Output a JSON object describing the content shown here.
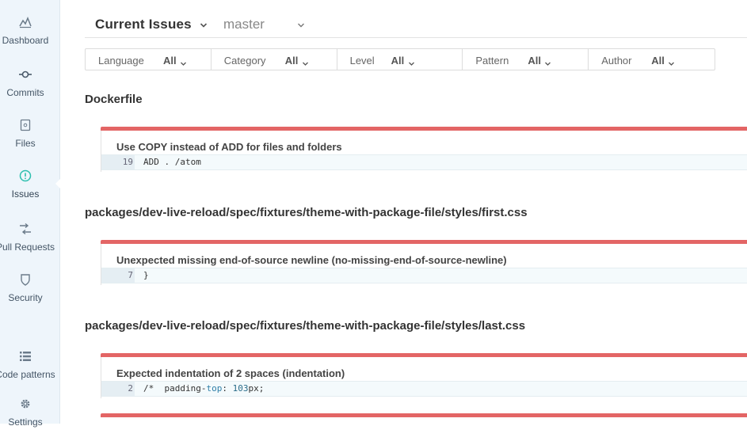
{
  "sidebar": {
    "items": [
      {
        "label": "Dashboard",
        "icon": "dashboard-icon"
      },
      {
        "label": "Commits",
        "icon": "commit-icon"
      },
      {
        "label": "Files",
        "icon": "file-icon"
      },
      {
        "label": "Issues",
        "icon": "alert-circle-icon",
        "active": true
      },
      {
        "label": "Pull Requests",
        "icon": "pull-request-icon"
      },
      {
        "label": "Security",
        "icon": "shield-icon"
      },
      {
        "label": "Code patterns",
        "icon": "list-icon"
      },
      {
        "label": "Settings",
        "icon": "gear-icon"
      }
    ]
  },
  "header": {
    "title": "Current Issues",
    "branch": "master"
  },
  "filters": [
    {
      "name": "Language",
      "value": "All"
    },
    {
      "name": "Category",
      "value": "All"
    },
    {
      "name": "Level",
      "value": "All"
    },
    {
      "name": "Pattern",
      "value": "All"
    },
    {
      "name": "Author",
      "value": "All"
    }
  ],
  "files": [
    {
      "path": "Dockerfile",
      "issues": [
        {
          "message": "Use COPY instead of ADD for files and folders",
          "line": "19",
          "code": "ADD . /atom"
        }
      ]
    },
    {
      "path": "packages/dev-live-reload/spec/fixtures/theme-with-package-file/styles/first.css",
      "issues": [
        {
          "message": "Unexpected missing end-of-source newline (no-missing-end-of-source-newline)",
          "line": "7",
          "code": "}"
        }
      ]
    },
    {
      "path": "packages/dev-live-reload/spec/fixtures/theme-with-package-file/styles/last.css",
      "issues": [
        {
          "message": "Expected indentation of 2 spaces (indentation)",
          "line": "2",
          "code_parts": [
            "/*  padding-",
            "top",
            ": ",
            "103",
            "px;"
          ]
        }
      ]
    }
  ],
  "colors": {
    "severity_bar": "#e36565",
    "sidebar_bg": "#eef5fb",
    "active_icon": "#2cbfae"
  }
}
